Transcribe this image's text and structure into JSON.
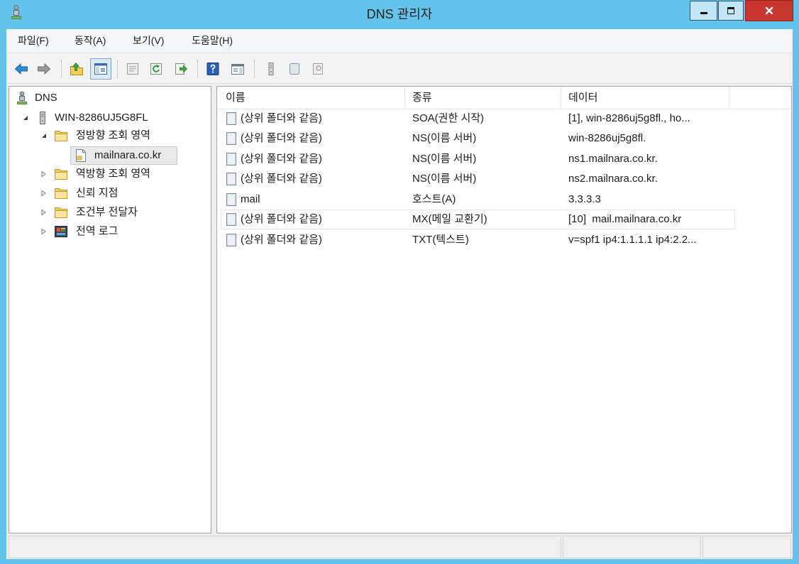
{
  "window": {
    "title": "DNS 관리자",
    "app_icon": "dns-manager-icon",
    "frame_color": "#63C3EB",
    "close_button_color": "#C7372F",
    "controls": [
      "minimize-icon",
      "maximize-icon",
      "close-icon"
    ]
  },
  "menu": {
    "items": [
      {
        "label": "파일(F)"
      },
      {
        "label": "동작(A)"
      },
      {
        "label": "보기(V)"
      },
      {
        "label": "도움말(H)"
      }
    ]
  },
  "toolbar": {
    "buttons": [
      {
        "icon": "back-arrow-icon"
      },
      {
        "icon": "forward-arrow-icon"
      },
      {
        "icon": "up-one-level-icon"
      },
      {
        "icon": "show-hide-console-tree-icon",
        "pressed": true
      },
      {
        "icon": "properties-icon"
      },
      {
        "icon": "refresh-icon"
      },
      {
        "icon": "export-list-icon"
      },
      {
        "icon": "help-icon"
      },
      {
        "icon": "show-hide-action-pane-icon"
      },
      {
        "icon": "update-server-data-file-icon"
      },
      {
        "icon": "new-record-icon"
      },
      {
        "icon": "record-properties-icon"
      }
    ]
  },
  "tree": {
    "label": "DNS",
    "icon": "dns-icon",
    "selection_color": "#EAEAEA",
    "children": [
      {
        "label": "WIN-8286UJ5G8FL",
        "icon": "server-icon",
        "expander": "expanded-arrow-icon",
        "children": [
          {
            "label": "정방향 조회 영역",
            "icon": "folder-icon",
            "expander": "expanded-arrow-icon",
            "children": [
              {
                "label": "mailnara.co.kr",
                "icon": "zone-icon",
                "selected": true
              }
            ]
          },
          {
            "label": "역방향 조회 영역",
            "icon": "folder-icon",
            "expander": "collapsed-arrow-icon"
          },
          {
            "label": "신뢰 지점",
            "icon": "folder-icon",
            "expander": "collapsed-arrow-icon"
          },
          {
            "label": "조건부 전달자",
            "icon": "folder-icon",
            "expander": "collapsed-arrow-icon"
          },
          {
            "label": "전역 로그",
            "icon": "event-log-icon",
            "expander": "collapsed-arrow-icon"
          }
        ]
      }
    ]
  },
  "list": {
    "columns": [
      {
        "label": "이름"
      },
      {
        "label": "종류"
      },
      {
        "label": "데이터"
      }
    ],
    "rows": [
      {
        "icon": "record-icon",
        "name": "(상위 폴더와 같음)",
        "type": "SOA(권한 시작)",
        "data": "[1], win-8286uj5g8fl., ho..."
      },
      {
        "icon": "record-icon",
        "name": "(상위 폴더와 같음)",
        "type": "NS(이름 서버)",
        "data": "win-8286uj5g8fl."
      },
      {
        "icon": "record-icon",
        "name": "(상위 폴더와 같음)",
        "type": "NS(이름 서버)",
        "data": "ns1.mailnara.co.kr."
      },
      {
        "icon": "record-icon",
        "name": "(상위 폴더와 같음)",
        "type": "NS(이름 서버)",
        "data": "ns2.mailnara.co.kr."
      },
      {
        "icon": "record-icon",
        "name": "mail",
        "type": "호스트(A)",
        "data": "3.3.3.3"
      },
      {
        "icon": "record-icon",
        "name": "(상위 폴더와 같음)",
        "type": "MX(메일 교환기)",
        "data": "[10]  mail.mailnara.co.kr",
        "focused": true
      },
      {
        "icon": "record-icon",
        "name": "(상위 폴더와 같음)",
        "type": "TXT(텍스트)",
        "data": "v=spf1 ip4:1.1.1.1 ip4:2.2..."
      }
    ]
  }
}
